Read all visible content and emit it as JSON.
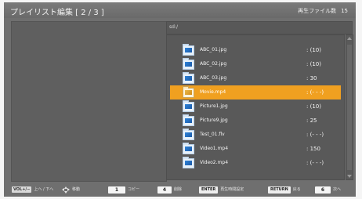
{
  "header": {
    "title": "プレイリスト編集 [ 2 / 3 ]",
    "file_count_label": "再生ファイル数",
    "file_count_value": "15"
  },
  "path": "sd:/",
  "files": [
    {
      "name": "ABC_01.jpg",
      "value": ": (10)",
      "selected": false
    },
    {
      "name": "ABC_02.jpg",
      "value": ": (10)",
      "selected": false
    },
    {
      "name": "ABC_03.jpg",
      "value": ": 30",
      "selected": false
    },
    {
      "name": "Movie.mp4",
      "value": ": (- - -)",
      "selected": true
    },
    {
      "name": "Picture1.jpg",
      "value": ": (10)",
      "selected": false
    },
    {
      "name": "Picture9.jpg",
      "value": ": 25",
      "selected": false
    },
    {
      "name": "Test_01.flv",
      "value": ": (- - -)",
      "selected": false
    },
    {
      "name": "Video1.mp4",
      "value": ": 150",
      "selected": false
    },
    {
      "name": "Video2.mp4",
      "value": ": (- - -)",
      "selected": false
    }
  ],
  "footer": {
    "vol_key": "VOL+/−",
    "vol_label": "上へ / 下へ",
    "move_label": "移動",
    "copy_key": "1",
    "copy_label": "コピー",
    "delete_key": "4",
    "delete_label": "削除",
    "enter_key": "ENTER",
    "enter_label": "再生時間設定",
    "return_key": "RETURN",
    "return_label": "戻る",
    "next_key": "6",
    "next_label": "次へ"
  },
  "colors": {
    "accent": "#f0a020",
    "panel": "#595959",
    "background": "#6f6f6f"
  }
}
